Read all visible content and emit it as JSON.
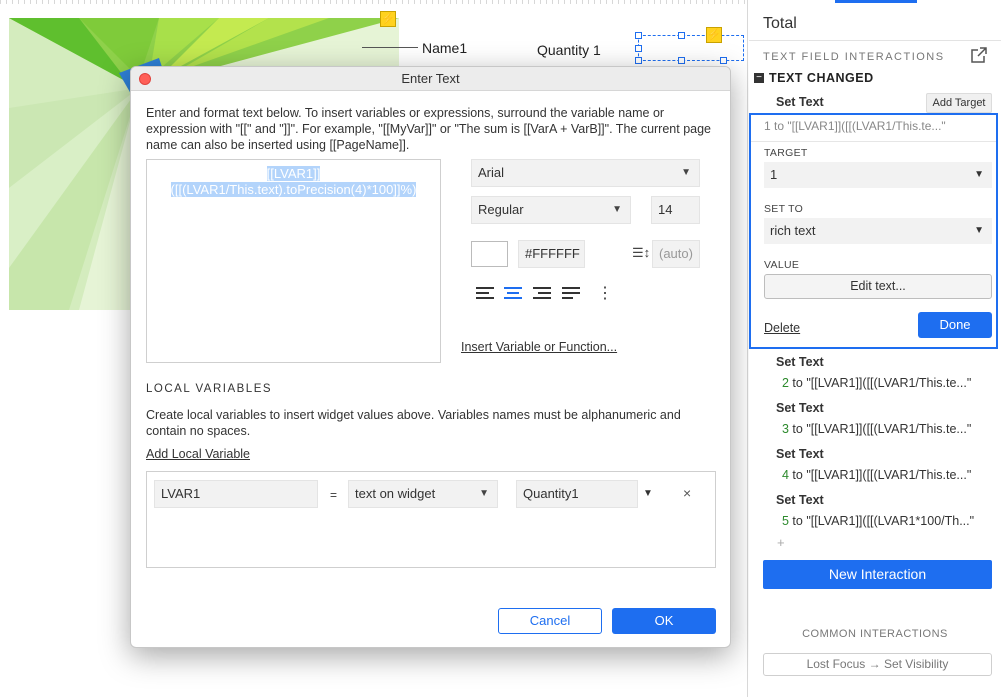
{
  "canvas": {
    "name_label": "Name1",
    "quantity_label": "Quantity 1",
    "flag_icon": "lightning-icon"
  },
  "dialog": {
    "title": "Enter Text",
    "description": "Enter and format text below. To insert variables or expressions, surround the variable name or expression with \"[[\" and \"]]\". For example, \"[[MyVar]]\" or \"The sum is [[VarA + VarB]]\". The current page name can also be inserted using [[PageName]].",
    "editor_line1": "[[LVAR1]]",
    "editor_line2": "([[(LVAR1/This.text).toPrecision(4)*100]]%)",
    "font_family": "Arial",
    "font_style": "Regular",
    "font_size": "14",
    "color_hex": "#FFFFFF",
    "line_height": "(auto)",
    "insert_link": "Insert Variable or Function...",
    "local_vars_heading": "LOCAL VARIABLES",
    "local_vars_desc": "Create local variables to insert widget values above. Variables names must be alphanumeric and contain no spaces.",
    "add_local_var": "Add Local Variable",
    "var_name": "LVAR1",
    "var_equals": "=",
    "var_type": "text on widget",
    "var_target": "Quantity1",
    "remove_glyph": "×",
    "cancel_label": "Cancel",
    "ok_label": "OK"
  },
  "panel": {
    "title": "Total",
    "section": "TEXT FIELD INTERACTIONS",
    "event": "TEXT CHANGED",
    "action": "Set Text",
    "add_target": "Add Target",
    "editing": {
      "summary": "1 to \"[[LVAR1]]([[(LVAR1/This.te...\"",
      "target_label": "TARGET",
      "target_value": "1",
      "set_to_label": "SET TO",
      "set_to_value": "rich text",
      "value_label": "VALUE",
      "edit_text": "Edit text...",
      "delete": "Delete",
      "done": "Done"
    },
    "actions": [
      {
        "title": "Set Text",
        "num": "2",
        "text": " to \"[[LVAR1]]([[(LVAR1/This.te...\""
      },
      {
        "title": "Set Text",
        "num": "3",
        "text": " to \"[[LVAR1]]([[(LVAR1/This.te...\""
      },
      {
        "title": "Set Text",
        "num": "4",
        "text": " to \"[[LVAR1]]([[(LVAR1/This.te...\""
      },
      {
        "title": "Set Text",
        "num": "5",
        "text": " to \"[[LVAR1]]([[(LVAR1*100/Th...\""
      }
    ],
    "add_glyph": "+",
    "new_interaction": "New Interaction",
    "common_heading": "COMMON INTERACTIONS",
    "common_item": "Lost Focus → Set Visibility"
  }
}
